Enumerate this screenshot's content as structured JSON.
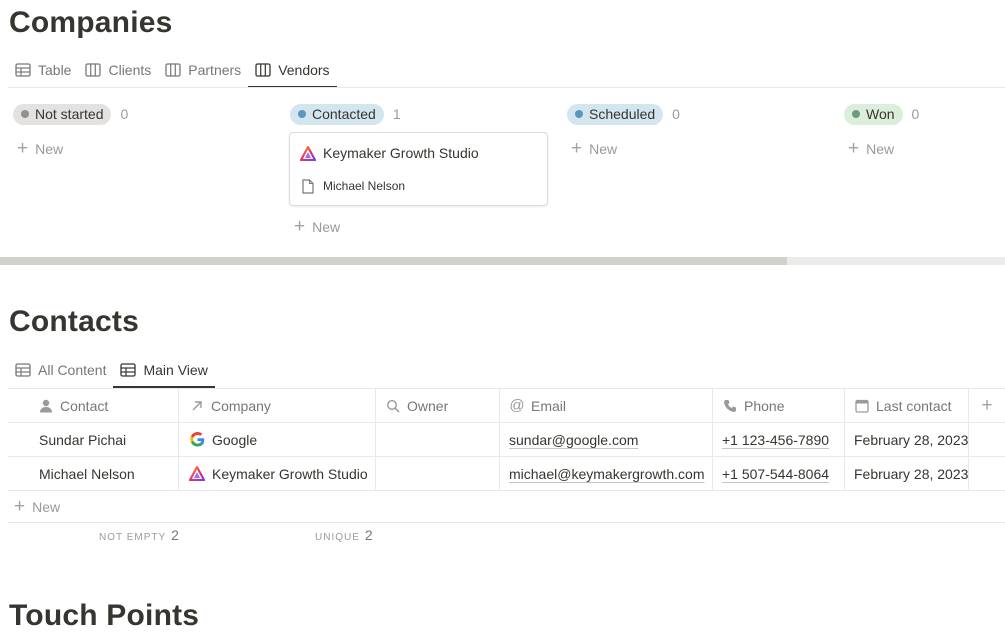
{
  "companies": {
    "title": "Companies",
    "tabs": [
      {
        "label": "Table",
        "icon": "table-icon"
      },
      {
        "label": "Clients",
        "icon": "board-icon"
      },
      {
        "label": "Partners",
        "icon": "board-icon"
      },
      {
        "label": "Vendors",
        "icon": "board-icon",
        "active": true
      }
    ],
    "new_label": "New",
    "columns": [
      {
        "status": "Not started",
        "count": "0",
        "pill_bg": "#e3e2e0",
        "dot": "#91918e"
      },
      {
        "status": "Contacted",
        "count": "1",
        "pill_bg": "#d3e5ef",
        "dot": "#5a97bd"
      },
      {
        "status": "Scheduled",
        "count": "0",
        "pill_bg": "#d3e5ef",
        "dot": "#5a97bd"
      },
      {
        "status": "Won",
        "count": "0",
        "pill_bg": "#dbeddb",
        "dot": "#6c9b7d"
      }
    ],
    "card": {
      "title": "Keymaker Growth Studio",
      "contact": "Michael Nelson"
    }
  },
  "contacts": {
    "title": "Contacts",
    "tabs": [
      {
        "label": "All Content",
        "icon": "table-icon"
      },
      {
        "label": "Main View",
        "icon": "table-icon",
        "active": true
      }
    ],
    "headers": [
      "Contact",
      "Company",
      "Owner",
      "Email",
      "Phone",
      "Last contact"
    ],
    "rows": [
      {
        "contact": "Sundar Pichai",
        "company": "Google",
        "owner": "",
        "email": "sundar@google.com",
        "phone": "+1 123-456-7890",
        "last_contact": "February 28, 2023"
      },
      {
        "contact": "Michael Nelson",
        "company": "Keymaker Growth Studio",
        "owner": "",
        "email": "michael@keymakergrowth.com",
        "phone": "+1 507-544-8064",
        "last_contact": "February 28, 2023"
      }
    ],
    "new_label": "New",
    "calc": [
      {
        "label": "NOT EMPTY",
        "value": "2"
      },
      {
        "label": "UNIQUE",
        "value": "2"
      }
    ]
  },
  "touch_points": {
    "title": "Touch Points"
  },
  "colors": {
    "text": "#37352f",
    "muted": "#787774",
    "border": "#e9e9e7"
  }
}
